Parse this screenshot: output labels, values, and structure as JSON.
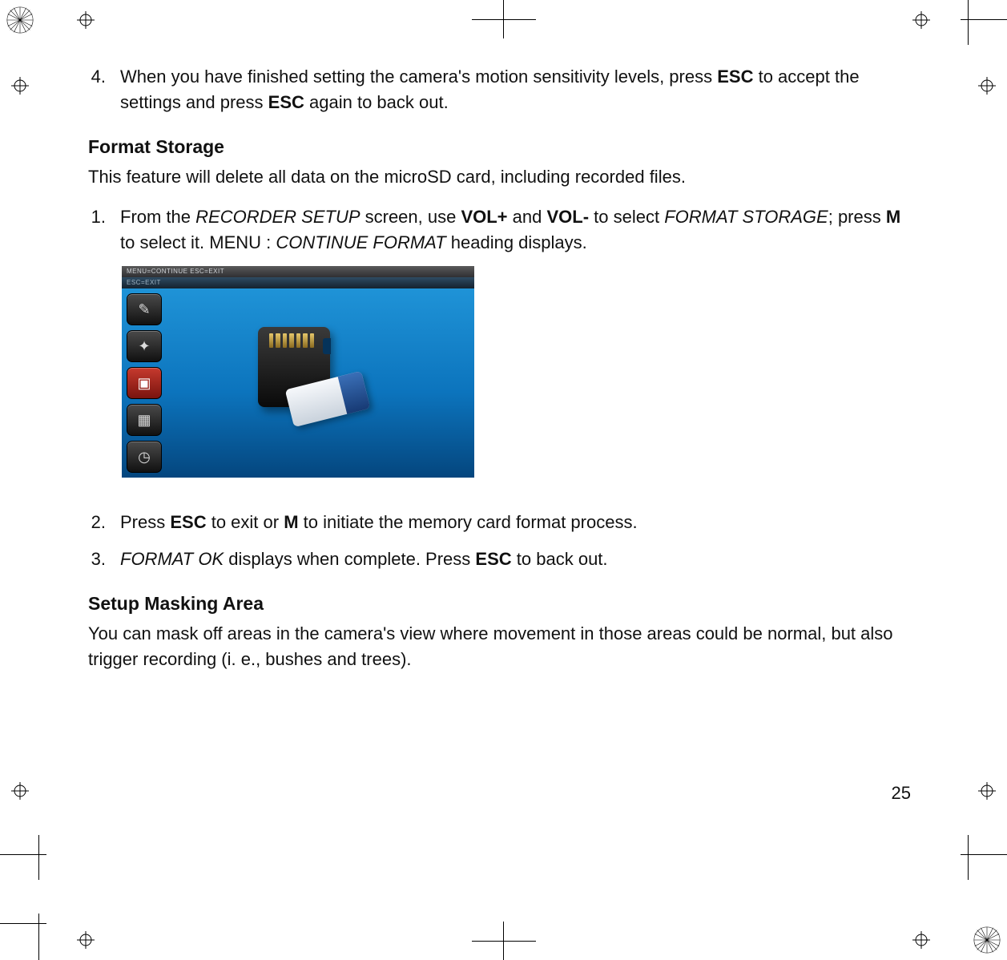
{
  "step4": {
    "num": "4.",
    "pre": "When you have finished setting the camera's motion sensitivity levels, press ",
    "esc1": "ESC",
    "mid": " to accept the settings and press ",
    "esc2": "ESC",
    "post": " again to back out."
  },
  "formatStorage": {
    "heading": "Format Storage",
    "intro": "This feature will delete all data on the microSD card, including recorded files.",
    "s1": {
      "num": "1.",
      "a": "From the ",
      "b": "RECORDER SETUP",
      "c": " screen, use ",
      "d": "VOL+",
      "e": " and ",
      "f": "VOL-",
      "g": " to select ",
      "h": "FORMAT STORAGE",
      "i": "; press ",
      "j": "M",
      "k": " to select it. MENU : ",
      "l": "CONTINUE FORMAT",
      "m": " heading displays."
    },
    "shot": {
      "bar1": "MENU=CONTINUE ESC=EXIT",
      "bar2": "ESC=EXIT"
    },
    "s2": {
      "num": "2.",
      "a": "Press ",
      "b": "ESC",
      "c": " to exit or ",
      "d": "M",
      "e": " to initiate the memory card format process."
    },
    "s3": {
      "num": "3.",
      "a": "FORMAT OK",
      "b": " displays when complete. Press ",
      "c": "ESC",
      "d": " to back out."
    }
  },
  "masking": {
    "heading": "Setup Masking Area",
    "intro": "You can mask off areas in the camera's view where movement in those areas could be normal, but also trigger recording (i. e., bushes and trees)."
  },
  "pageNumber": "25"
}
